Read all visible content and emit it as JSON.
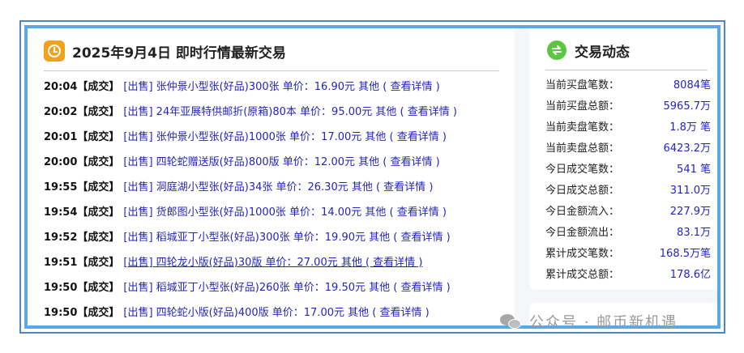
{
  "left_panel": {
    "title": "2025年9月4日 即时行情最新交易",
    "icon": "clock-icon",
    "trades": [
      {
        "time": "20:04",
        "status": "【成交】",
        "text": "[出售] 张仲景小型张(好品)300张 单价：16.90元 其他 ( 查看详情 )"
      },
      {
        "time": "20:02",
        "status": "【成交】",
        "text": "[出售] 24年亚展特供邮折(原箱)80本 单价：95.00元 其他 ( 查看详情 )"
      },
      {
        "time": "20:01",
        "status": "【成交】",
        "text": "[出售] 张仲景小型张(好品)1000张 单价：17.00元 其他 ( 查看详情 )"
      },
      {
        "time": "20:00",
        "status": "【成交】",
        "text": "[出售] 四轮蛇赠送版(好品)800版 单价：12.00元 其他 ( 查看详情 )"
      },
      {
        "time": "19:55",
        "status": "【成交】",
        "text": "[出售] 洞庭湖小型张(好品)34张 单价：26.30元 其他 ( 查看详情 )"
      },
      {
        "time": "19:54",
        "status": "【成交】",
        "text": "[出售] 货郎图小型张(好品)1000张 单价：14.00元 其他 ( 查看详情 )"
      },
      {
        "time": "19:52",
        "status": "【成交】",
        "text": "[出售] 稻城亚丁小型张(好品)300张 单价：19.90元 其他 ( 查看详情 )"
      },
      {
        "time": "19:51",
        "status": "【成交】",
        "text": "[出售] 四轮龙小版(好品)30版 单价：27.00元 其他 ( 查看详情 )",
        "underlined": true
      },
      {
        "time": "19:50",
        "status": "【成交】",
        "text": "[出售] 稻城亚丁小型张(好品)260张 单价：19.50元 其他 ( 查看详情 )"
      },
      {
        "time": "19:50",
        "status": "【成交】",
        "text": "[出售] 四轮蛇小版(好品)400版 单价：17.00元 其他 ( 查看详情 )"
      }
    ]
  },
  "right_panel": {
    "title": "交易动态",
    "icon": "swap-icon",
    "stats": [
      {
        "label": "当前买盘笔数：",
        "value": "8084笔"
      },
      {
        "label": "当前买盘总额：",
        "value": "5965.7万"
      },
      {
        "label": "当前卖盘笔数：",
        "value": "1.8万 笔"
      },
      {
        "label": "当前卖盘总额：",
        "value": "6423.2万"
      },
      {
        "label": "今日成交笔数：",
        "value": "541 笔"
      },
      {
        "label": "今日成交总额：",
        "value": "311.0万"
      },
      {
        "label": "今日金额流入：",
        "value": "227.9万"
      },
      {
        "label": "今日金额流出：",
        "value": "83.1万"
      },
      {
        "label": "累计成交笔数：",
        "value": "168.5万笔"
      },
      {
        "label": "累计成交总额：",
        "value": "178.6亿"
      }
    ]
  },
  "watermark": {
    "icon": "wechat-icon",
    "text": "公众号 · 邮币新机遇"
  }
}
